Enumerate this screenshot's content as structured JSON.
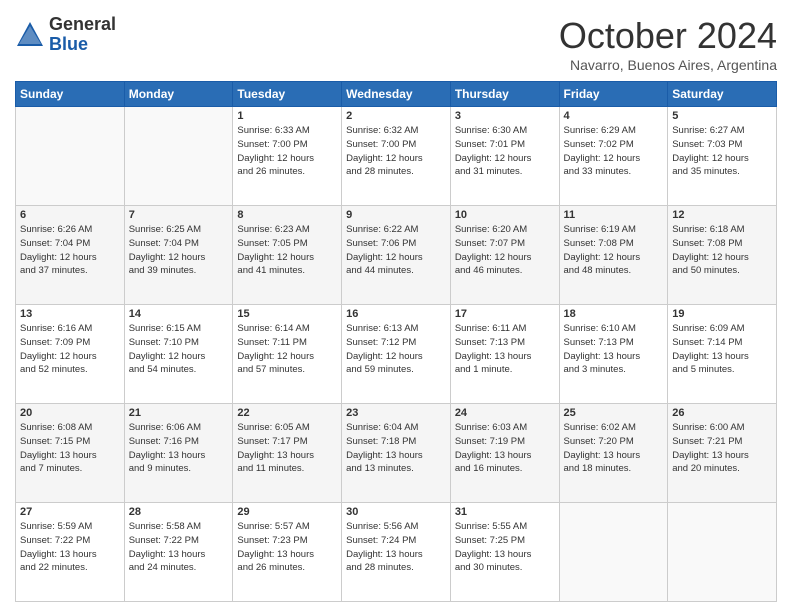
{
  "logo": {
    "general": "General",
    "blue": "Blue"
  },
  "title": "October 2024",
  "location": "Navarro, Buenos Aires, Argentina",
  "days_of_week": [
    "Sunday",
    "Monday",
    "Tuesday",
    "Wednesday",
    "Thursday",
    "Friday",
    "Saturday"
  ],
  "weeks": [
    [
      {
        "day": "",
        "info": ""
      },
      {
        "day": "",
        "info": ""
      },
      {
        "day": "1",
        "info": "Sunrise: 6:33 AM\nSunset: 7:00 PM\nDaylight: 12 hours\nand 26 minutes."
      },
      {
        "day": "2",
        "info": "Sunrise: 6:32 AM\nSunset: 7:00 PM\nDaylight: 12 hours\nand 28 minutes."
      },
      {
        "day": "3",
        "info": "Sunrise: 6:30 AM\nSunset: 7:01 PM\nDaylight: 12 hours\nand 31 minutes."
      },
      {
        "day": "4",
        "info": "Sunrise: 6:29 AM\nSunset: 7:02 PM\nDaylight: 12 hours\nand 33 minutes."
      },
      {
        "day": "5",
        "info": "Sunrise: 6:27 AM\nSunset: 7:03 PM\nDaylight: 12 hours\nand 35 minutes."
      }
    ],
    [
      {
        "day": "6",
        "info": "Sunrise: 6:26 AM\nSunset: 7:04 PM\nDaylight: 12 hours\nand 37 minutes."
      },
      {
        "day": "7",
        "info": "Sunrise: 6:25 AM\nSunset: 7:04 PM\nDaylight: 12 hours\nand 39 minutes."
      },
      {
        "day": "8",
        "info": "Sunrise: 6:23 AM\nSunset: 7:05 PM\nDaylight: 12 hours\nand 41 minutes."
      },
      {
        "day": "9",
        "info": "Sunrise: 6:22 AM\nSunset: 7:06 PM\nDaylight: 12 hours\nand 44 minutes."
      },
      {
        "day": "10",
        "info": "Sunrise: 6:20 AM\nSunset: 7:07 PM\nDaylight: 12 hours\nand 46 minutes."
      },
      {
        "day": "11",
        "info": "Sunrise: 6:19 AM\nSunset: 7:08 PM\nDaylight: 12 hours\nand 48 minutes."
      },
      {
        "day": "12",
        "info": "Sunrise: 6:18 AM\nSunset: 7:08 PM\nDaylight: 12 hours\nand 50 minutes."
      }
    ],
    [
      {
        "day": "13",
        "info": "Sunrise: 6:16 AM\nSunset: 7:09 PM\nDaylight: 12 hours\nand 52 minutes."
      },
      {
        "day": "14",
        "info": "Sunrise: 6:15 AM\nSunset: 7:10 PM\nDaylight: 12 hours\nand 54 minutes."
      },
      {
        "day": "15",
        "info": "Sunrise: 6:14 AM\nSunset: 7:11 PM\nDaylight: 12 hours\nand 57 minutes."
      },
      {
        "day": "16",
        "info": "Sunrise: 6:13 AM\nSunset: 7:12 PM\nDaylight: 12 hours\nand 59 minutes."
      },
      {
        "day": "17",
        "info": "Sunrise: 6:11 AM\nSunset: 7:13 PM\nDaylight: 13 hours\nand 1 minute."
      },
      {
        "day": "18",
        "info": "Sunrise: 6:10 AM\nSunset: 7:13 PM\nDaylight: 13 hours\nand 3 minutes."
      },
      {
        "day": "19",
        "info": "Sunrise: 6:09 AM\nSunset: 7:14 PM\nDaylight: 13 hours\nand 5 minutes."
      }
    ],
    [
      {
        "day": "20",
        "info": "Sunrise: 6:08 AM\nSunset: 7:15 PM\nDaylight: 13 hours\nand 7 minutes."
      },
      {
        "day": "21",
        "info": "Sunrise: 6:06 AM\nSunset: 7:16 PM\nDaylight: 13 hours\nand 9 minutes."
      },
      {
        "day": "22",
        "info": "Sunrise: 6:05 AM\nSunset: 7:17 PM\nDaylight: 13 hours\nand 11 minutes."
      },
      {
        "day": "23",
        "info": "Sunrise: 6:04 AM\nSunset: 7:18 PM\nDaylight: 13 hours\nand 13 minutes."
      },
      {
        "day": "24",
        "info": "Sunrise: 6:03 AM\nSunset: 7:19 PM\nDaylight: 13 hours\nand 16 minutes."
      },
      {
        "day": "25",
        "info": "Sunrise: 6:02 AM\nSunset: 7:20 PM\nDaylight: 13 hours\nand 18 minutes."
      },
      {
        "day": "26",
        "info": "Sunrise: 6:00 AM\nSunset: 7:21 PM\nDaylight: 13 hours\nand 20 minutes."
      }
    ],
    [
      {
        "day": "27",
        "info": "Sunrise: 5:59 AM\nSunset: 7:22 PM\nDaylight: 13 hours\nand 22 minutes."
      },
      {
        "day": "28",
        "info": "Sunrise: 5:58 AM\nSunset: 7:22 PM\nDaylight: 13 hours\nand 24 minutes."
      },
      {
        "day": "29",
        "info": "Sunrise: 5:57 AM\nSunset: 7:23 PM\nDaylight: 13 hours\nand 26 minutes."
      },
      {
        "day": "30",
        "info": "Sunrise: 5:56 AM\nSunset: 7:24 PM\nDaylight: 13 hours\nand 28 minutes."
      },
      {
        "day": "31",
        "info": "Sunrise: 5:55 AM\nSunset: 7:25 PM\nDaylight: 13 hours\nand 30 minutes."
      },
      {
        "day": "",
        "info": ""
      },
      {
        "day": "",
        "info": ""
      }
    ]
  ]
}
